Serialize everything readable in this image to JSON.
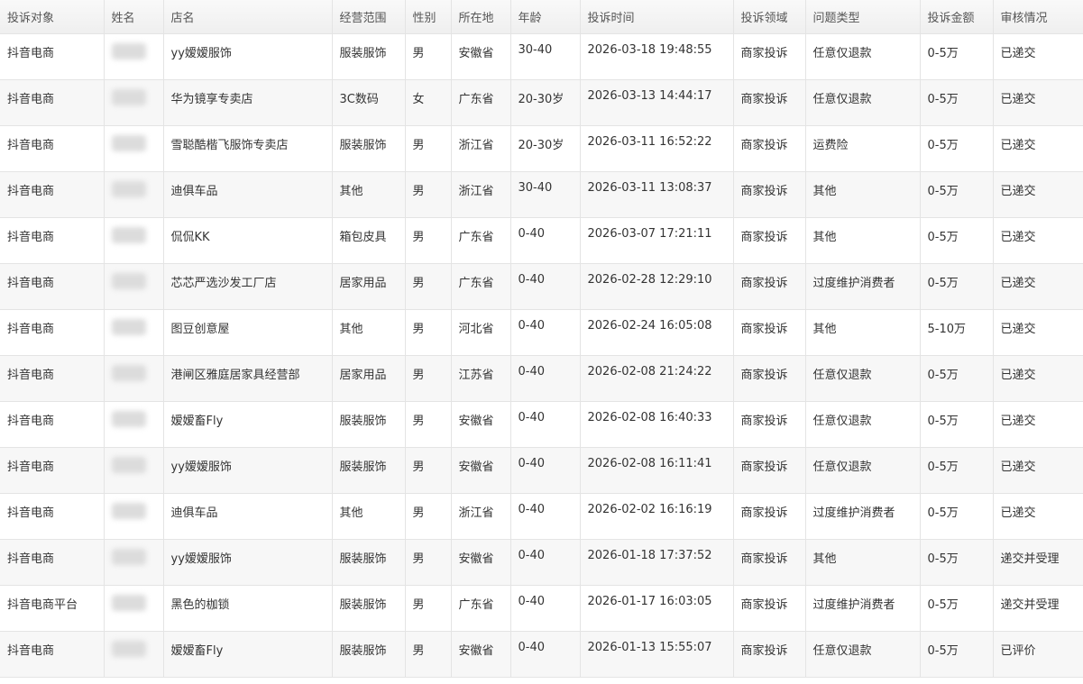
{
  "columns": [
    "投诉对象",
    "姓名",
    "店名",
    "经营范围",
    "性别",
    "所在地",
    "年龄",
    "投诉时间",
    "投诉领域",
    "问题类型",
    "投诉金额",
    "审核情况"
  ],
  "rows": [
    {
      "target": "抖音电商",
      "shop": "yy嫒嫒服饰",
      "scope": "服装服饰",
      "gender": "男",
      "location": "安徽省",
      "age": "30-40",
      "time": "2026-03-18 19:48:55",
      "field": "商家投诉",
      "issue": "任意仅退款",
      "amount": "0-5万",
      "status": "已递交"
    },
    {
      "target": "抖音电商",
      "shop": "华为镜享专卖店",
      "scope": "3C数码",
      "gender": "女",
      "location": "广东省",
      "age": "20-30岁",
      "time": "2026-03-13 14:44:17",
      "field": "商家投诉",
      "issue": "任意仅退款",
      "amount": "0-5万",
      "status": "已递交"
    },
    {
      "target": "抖音电商",
      "shop": "雪聪酷楷飞服饰专卖店",
      "scope": "服装服饰",
      "gender": "男",
      "location": "浙江省",
      "age": "20-30岁",
      "time": "2026-03-11 16:52:22",
      "field": "商家投诉",
      "issue": "运费险",
      "amount": "0-5万",
      "status": "已递交"
    },
    {
      "target": "抖音电商",
      "shop": "迪俱车品",
      "scope": "其他",
      "gender": "男",
      "location": "浙江省",
      "age": "30-40",
      "time": "2026-03-11 13:08:37",
      "field": "商家投诉",
      "issue": "其他",
      "amount": "0-5万",
      "status": "已递交"
    },
    {
      "target": "抖音电商",
      "shop": "侃侃KK",
      "scope": "箱包皮具",
      "gender": "男",
      "location": "广东省",
      "age": "0-40",
      "time": "2026-03-07 17:21:11",
      "field": "商家投诉",
      "issue": "其他",
      "amount": "0-5万",
      "status": "已递交"
    },
    {
      "target": "抖音电商",
      "shop": "芯芯严选沙发工厂店",
      "scope": "居家用品",
      "gender": "男",
      "location": "广东省",
      "age": "0-40",
      "time": "2026-02-28 12:29:10",
      "field": "商家投诉",
      "issue": "过度维护消费者",
      "amount": "0-5万",
      "status": "已递交"
    },
    {
      "target": "抖音电商",
      "shop": "图豆创意屋",
      "scope": "其他",
      "gender": "男",
      "location": "河北省",
      "age": "0-40",
      "time": "2026-02-24 16:05:08",
      "field": "商家投诉",
      "issue": "其他",
      "amount": "5-10万",
      "status": "已递交"
    },
    {
      "target": "抖音电商",
      "shop": "港闸区雅庭居家具经营部",
      "scope": "居家用品",
      "gender": "男",
      "location": "江苏省",
      "age": "0-40",
      "time": "2026-02-08 21:24:22",
      "field": "商家投诉",
      "issue": "任意仅退款",
      "amount": "0-5万",
      "status": "已递交"
    },
    {
      "target": "抖音电商",
      "shop": "嫒嫒畜Fly",
      "scope": "服装服饰",
      "gender": "男",
      "location": "安徽省",
      "age": "0-40",
      "time": "2026-02-08 16:40:33",
      "field": "商家投诉",
      "issue": "任意仅退款",
      "amount": "0-5万",
      "status": "已递交"
    },
    {
      "target": "抖音电商",
      "shop": "yy嫒嫒服饰",
      "scope": "服装服饰",
      "gender": "男",
      "location": "安徽省",
      "age": "0-40",
      "time": "2026-02-08 16:11:41",
      "field": "商家投诉",
      "issue": "任意仅退款",
      "amount": "0-5万",
      "status": "已递交"
    },
    {
      "target": "抖音电商",
      "shop": "迪俱车品",
      "scope": "其他",
      "gender": "男",
      "location": "浙江省",
      "age": "0-40",
      "time": "2026-02-02 16:16:19",
      "field": "商家投诉",
      "issue": "过度维护消费者",
      "amount": "0-5万",
      "status": "已递交"
    },
    {
      "target": "抖音电商",
      "shop": "yy嫒嫒服饰",
      "scope": "服装服饰",
      "gender": "男",
      "location": "安徽省",
      "age": "0-40",
      "time": "2026-01-18 17:37:52",
      "field": "商家投诉",
      "issue": "其他",
      "amount": "0-5万",
      "status": "递交并受理"
    },
    {
      "target": "抖音电商平台",
      "shop": "黑色的枷锁",
      "scope": "服装服饰",
      "gender": "男",
      "location": "广东省",
      "age": "0-40",
      "time": "2026-01-17 16:03:05",
      "field": "商家投诉",
      "issue": "过度维护消费者",
      "amount": "0-5万",
      "status": "递交并受理"
    },
    {
      "target": "抖音电商",
      "shop": "嫒嫒畜Fly",
      "scope": "服装服饰",
      "gender": "男",
      "location": "安徽省",
      "age": "0-40",
      "time": "2026-01-13 15:55:07",
      "field": "商家投诉",
      "issue": "任意仅退款",
      "amount": "0-5万",
      "status": "已评价"
    }
  ]
}
